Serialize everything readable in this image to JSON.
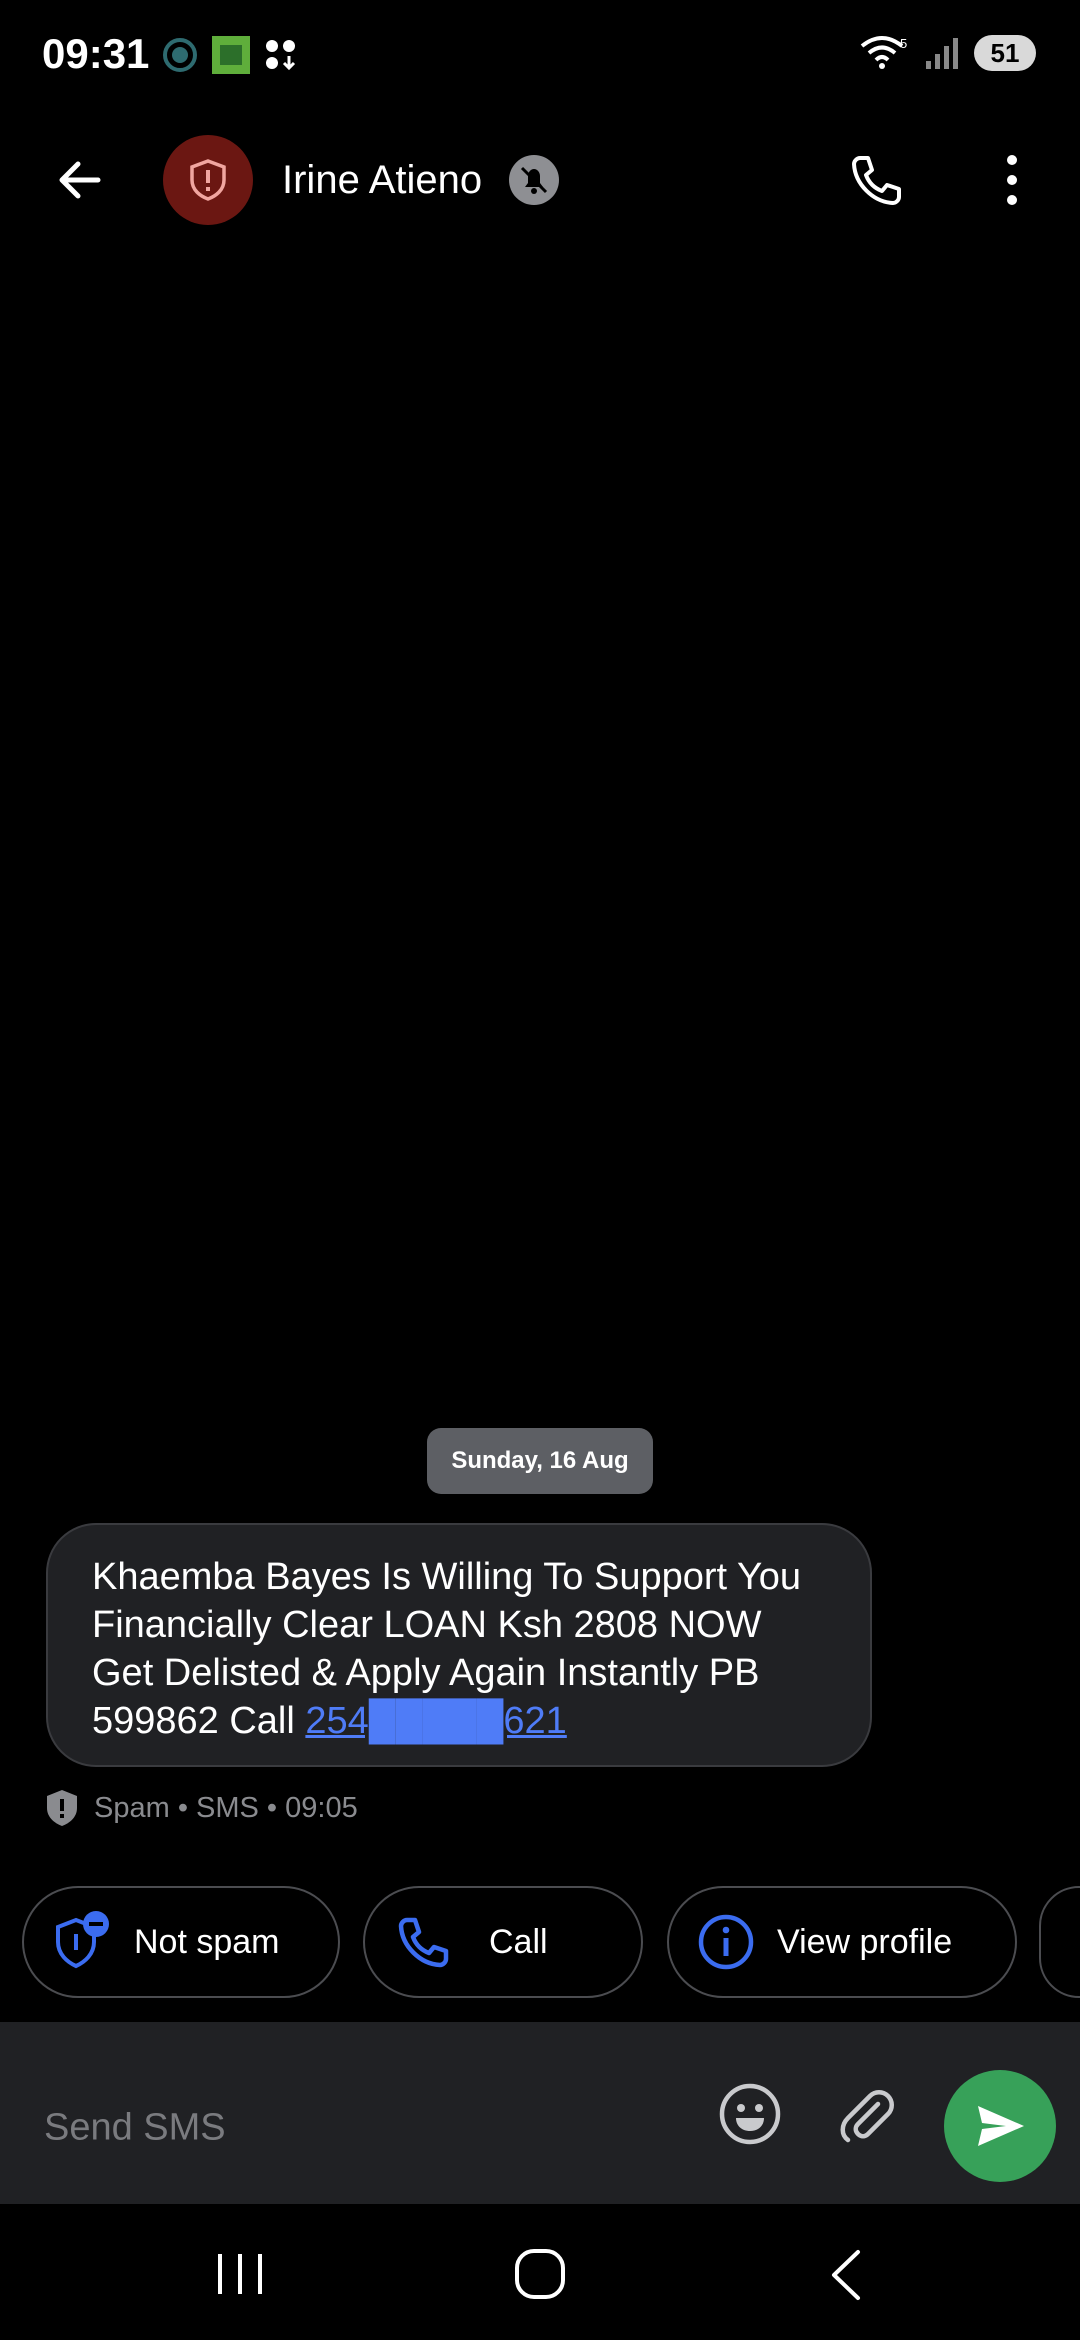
{
  "status_bar": {
    "time": "09:31",
    "battery": "51",
    "icons_left": [
      "whatsapp-icon",
      "kcb-app-icon",
      "app-grid-download-icon"
    ],
    "icons_right": [
      "wifi-icon",
      "signal-icon",
      "battery-icon"
    ]
  },
  "header": {
    "contact_name": "Irine Atieno",
    "avatar_icon": "shield-alert-icon",
    "muted_icon": "bell-off-icon"
  },
  "conversation": {
    "date_label": "Sunday, 16 Aug",
    "message": {
      "text_part": "Khaemba Bayes Is Willing To Support You Financially Clear LOAN Ksh 2808 NOW Get Delisted & Apply Again Instantly PB 599862 Call ",
      "phone_link": "254█████621",
      "meta": "Spam • SMS • 09:05"
    }
  },
  "actions": {
    "not_spam": "Not spam",
    "call": "Call",
    "view_profile": "View profile"
  },
  "compose": {
    "placeholder": "Send SMS"
  },
  "colors": {
    "background": "#000000",
    "bubble": "#202124",
    "link": "#4f7cf7",
    "send_button": "#37a159",
    "avatar_bg": "#6b1712",
    "icon_blue": "#3b6cf0"
  }
}
